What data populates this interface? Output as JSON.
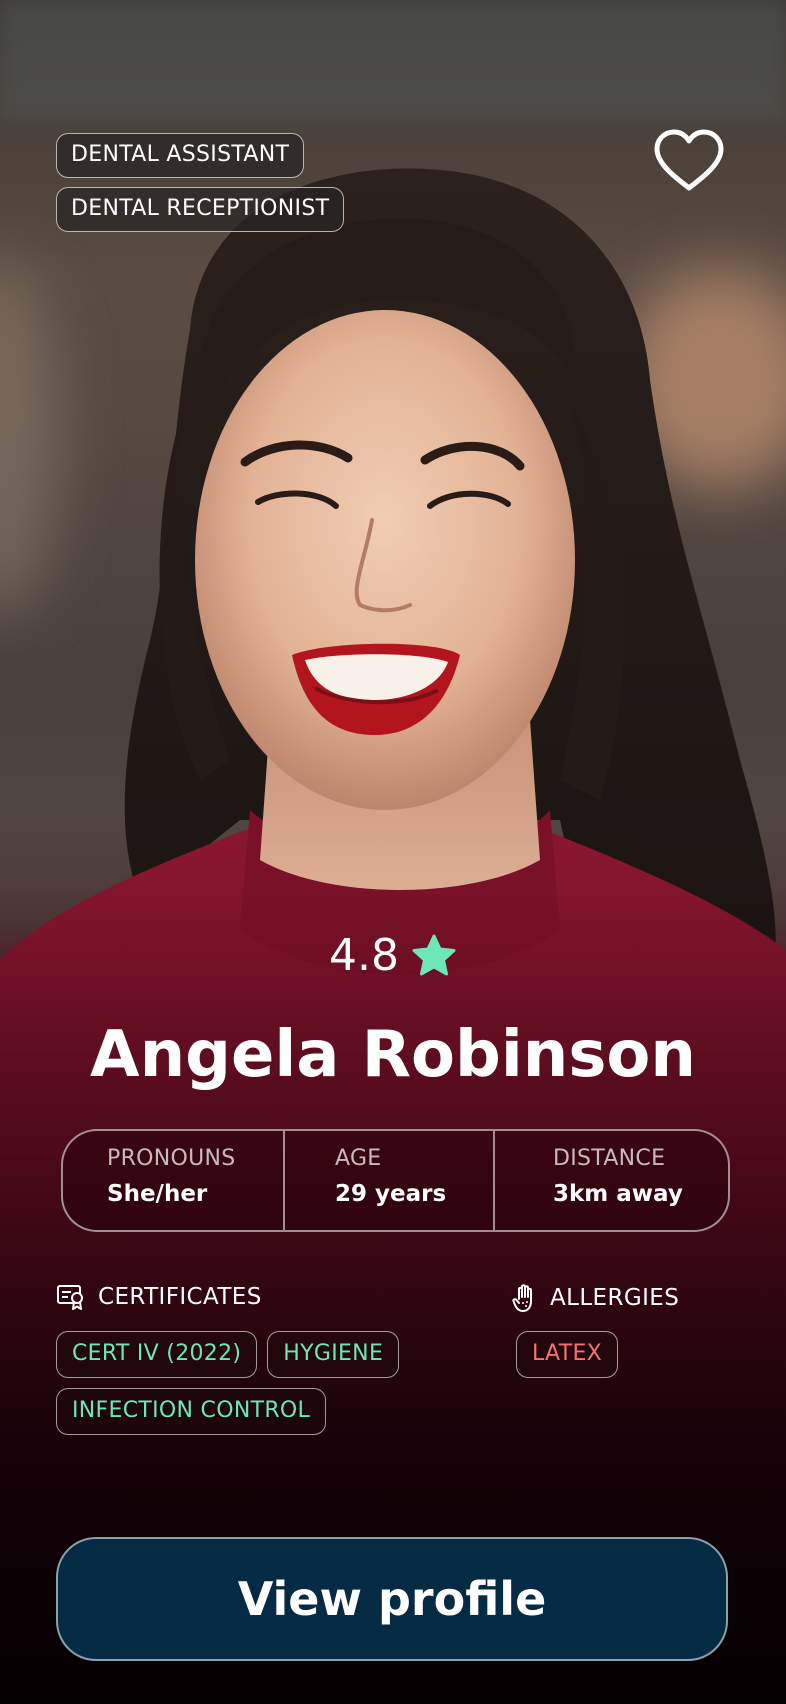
{
  "profile": {
    "roles": [
      "DENTAL ASSISTANT",
      "DENTAL RECEPTIONIST"
    ],
    "rating": "4.8",
    "name": "Angela Robinson",
    "info": {
      "pronouns_label": "PRONOUNS",
      "pronouns_value": "She/her",
      "age_label": "AGE",
      "age_value": "29 years",
      "distance_label": "DISTANCE",
      "distance_value": "3km away"
    },
    "certificates": {
      "title": "CERTIFICATES",
      "items": [
        "CERT IV (2022)",
        "HYGIENE",
        "INFECTION CONTROL"
      ]
    },
    "allergies": {
      "title": "ALLERGIES",
      "items": [
        "LATEX"
      ]
    }
  },
  "actions": {
    "view_profile_label": "View profile"
  },
  "icons": {
    "favorite": "heart-outline-icon",
    "rating": "star-icon",
    "certificates": "certificate-icon",
    "allergies": "hand-icon"
  },
  "colors": {
    "star": "#6ee7b7",
    "certificate_chip_text": "#6ee7b7",
    "allergy_chip_text": "#f87171",
    "button_background": "#052a44"
  }
}
